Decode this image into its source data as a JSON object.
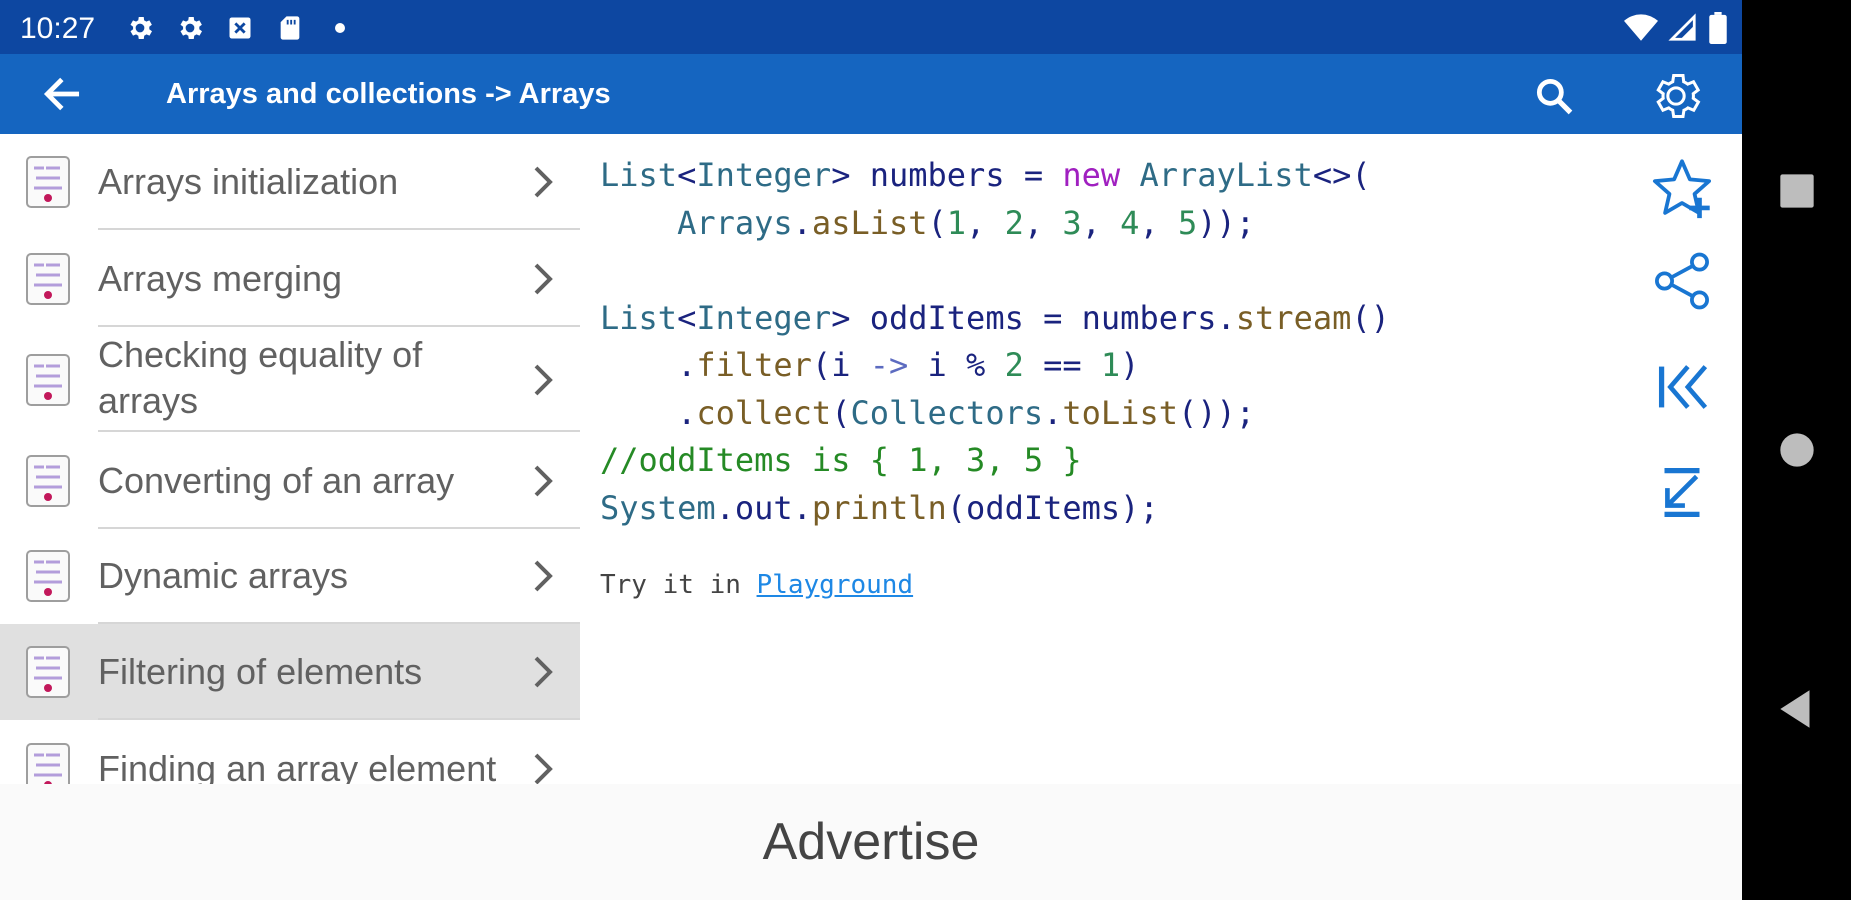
{
  "status_bar": {
    "time": "10:27",
    "left_icons": [
      "gear-icon",
      "gear-icon",
      "x-box-icon",
      "sd-card-icon",
      "dot-icon"
    ],
    "right_icons": [
      "wifi-icon",
      "signal-icon",
      "battery-icon"
    ]
  },
  "app_bar": {
    "title": "Arrays and collections -> Arrays",
    "colors": {
      "status": "#0d47a1",
      "bar": "#1565c0"
    }
  },
  "topics": [
    {
      "label": "Arrays initialization"
    },
    {
      "label": "Arrays merging"
    },
    {
      "label": "Checking equality of\narrays"
    },
    {
      "label": "Converting of an array"
    },
    {
      "label": "Dynamic arrays"
    },
    {
      "label": "Filtering of elements",
      "selected": true
    },
    {
      "label": "Finding an array element"
    }
  ],
  "code": {
    "lines": [
      "List<Integer> numbers = new ArrayList<>(",
      "    Arrays.asList(1, 2, 3, 4, 5));",
      "",
      "List<Integer> oddItems = numbers.stream()",
      "    .filter(i -> i % 2 == 1)",
      "    .collect(Collectors.toList());",
      "//oddItems is { 1, 3, 5 }",
      "System.out.println(oddItems);"
    ],
    "try_prefix": "Try it in ",
    "try_link": "Playground"
  },
  "side_actions": [
    "star-add-icon",
    "share-icon",
    "skip-first-icon",
    "skip-last-icon"
  ],
  "ad": {
    "label": "Advertise"
  },
  "nav_bar": [
    "recents-icon",
    "home-icon",
    "back-icon"
  ]
}
